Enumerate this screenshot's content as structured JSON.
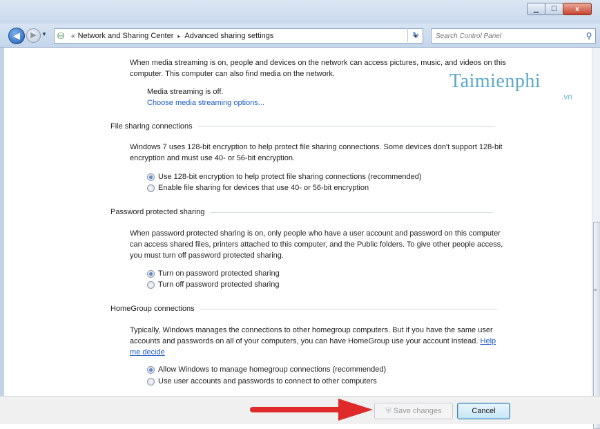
{
  "window": {
    "minimize_icon": "minimize-icon",
    "maximize_icon": "maximize-icon",
    "close_label": "x"
  },
  "address_bar": {
    "chevron": "«",
    "breadcrumbs": [
      "Network and Sharing Center",
      "Advanced sharing settings"
    ],
    "separator": "▸"
  },
  "search": {
    "placeholder": "Search Control Panel"
  },
  "watermark": {
    "main": "Taimienphi",
    "sub": ".vn"
  },
  "media_streaming": {
    "description": "When media streaming is on, people and devices on the network can access pictures, music, and videos on this computer. This computer can also find media on the network.",
    "status": "Media streaming is off.",
    "link": "Choose media streaming options..."
  },
  "file_sharing": {
    "heading": "File sharing connections",
    "description": "Windows 7 uses 128-bit encryption to help protect file sharing connections. Some devices don't support 128-bit encryption and must use 40- or 56-bit encryption.",
    "options": [
      {
        "label": "Use 128-bit encryption to help protect file sharing connections (recommended)",
        "selected": true
      },
      {
        "label": "Enable file sharing for devices that use 40- or 56-bit encryption",
        "selected": false
      }
    ]
  },
  "password_sharing": {
    "heading": "Password protected sharing",
    "description": "When password protected sharing is on, only people who have a user account and password on this computer can access shared files, printers attached to this computer, and the Public folders. To give other people access, you must turn off password protected sharing.",
    "options": [
      {
        "label": "Turn on password protected sharing",
        "selected": true
      },
      {
        "label": "Turn off password protected sharing",
        "selected": false
      }
    ]
  },
  "homegroup": {
    "heading": "HomeGroup connections",
    "description": "Typically, Windows manages the connections to other homegroup computers. But if you have the same user accounts and passwords on all of your computers, you can have HomeGroup use your account instead.",
    "help_link": "Help me decide",
    "options": [
      {
        "label": "Allow Windows to manage homegroup connections (recommended)",
        "selected": true
      },
      {
        "label": "Use user accounts and passwords to connect to other computers",
        "selected": false
      }
    ]
  },
  "buttons": {
    "save": "Save changes",
    "cancel": "Cancel"
  },
  "colors": {
    "link": "#1c5bc4",
    "annotation_arrow": "#e02a2a",
    "watermark": "#5aa9c8"
  }
}
